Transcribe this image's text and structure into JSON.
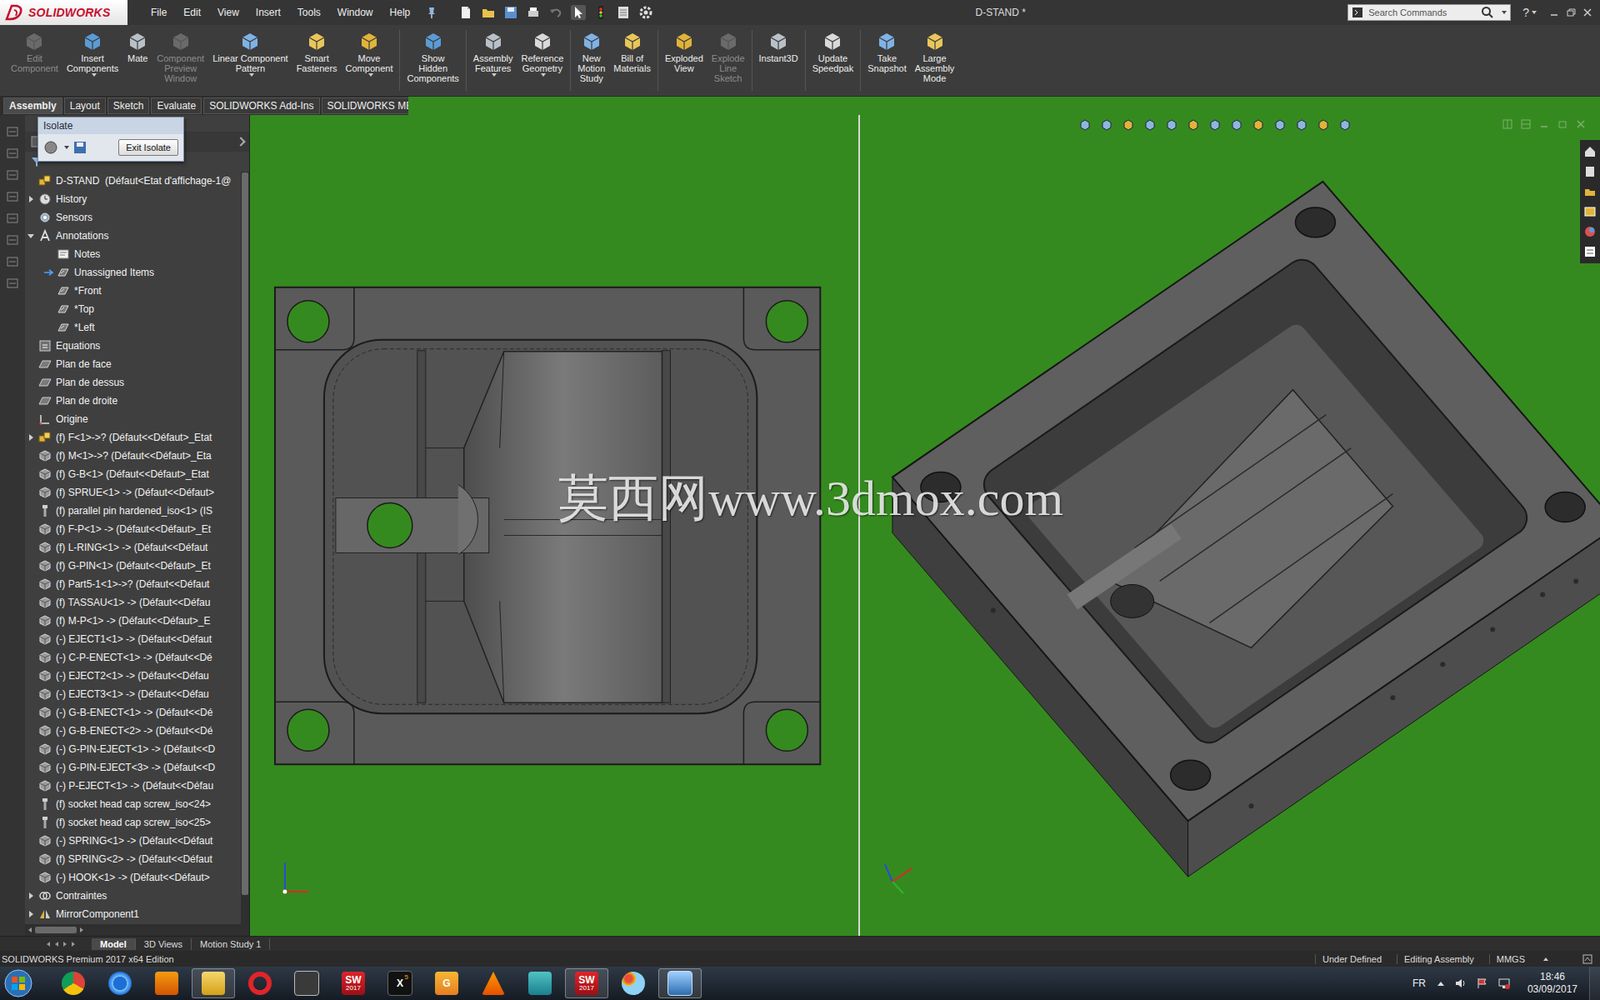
{
  "window": {
    "title": "D-STAND *"
  },
  "logo": {
    "text": "SOLIDWORKS"
  },
  "menu": [
    "File",
    "Edit",
    "View",
    "Insert",
    "Tools",
    "Window",
    "Help"
  ],
  "search": {
    "placeholder": "Search Commands"
  },
  "help": "?",
  "toolbar": [
    {
      "lines": [
        "Edit",
        "Component"
      ],
      "disabled": true,
      "dropdown": false,
      "sep_after": false
    },
    {
      "lines": [
        "Insert",
        "Components"
      ],
      "disabled": false,
      "dropdown": true,
      "sep_after": false
    },
    {
      "lines": [
        "Mate"
      ],
      "disabled": false,
      "dropdown": false,
      "sep_after": false
    },
    {
      "lines": [
        "Component",
        "Preview",
        "Window"
      ],
      "disabled": true,
      "dropdown": false,
      "sep_after": false
    },
    {
      "lines": [
        "Linear Component",
        "Pattern"
      ],
      "disabled": false,
      "dropdown": true,
      "sep_after": false
    },
    {
      "lines": [
        "Smart",
        "Fasteners"
      ],
      "disabled": false,
      "dropdown": false,
      "sep_after": false
    },
    {
      "lines": [
        "Move",
        "Component"
      ],
      "disabled": false,
      "dropdown": true,
      "sep_after": true
    },
    {
      "lines": [
        "Show",
        "Hidden",
        "Components"
      ],
      "disabled": false,
      "dropdown": false,
      "sep_after": true
    },
    {
      "lines": [
        "Assembly",
        "Features"
      ],
      "disabled": false,
      "dropdown": true,
      "sep_after": false
    },
    {
      "lines": [
        "Reference",
        "Geometry"
      ],
      "disabled": false,
      "dropdown": true,
      "sep_after": true
    },
    {
      "lines": [
        "New",
        "Motion",
        "Study"
      ],
      "disabled": false,
      "dropdown": false,
      "sep_after": false
    },
    {
      "lines": [
        "Bill of",
        "Materials"
      ],
      "disabled": false,
      "dropdown": false,
      "sep_after": true
    },
    {
      "lines": [
        "Exploded",
        "View"
      ],
      "disabled": false,
      "dropdown": false,
      "sep_after": false
    },
    {
      "lines": [
        "Explode",
        "Line",
        "Sketch"
      ],
      "disabled": true,
      "dropdown": false,
      "sep_after": true
    },
    {
      "lines": [
        "Instant3D"
      ],
      "disabled": false,
      "dropdown": false,
      "sep_after": true
    },
    {
      "lines": [
        "Update",
        "Speedpak"
      ],
      "disabled": false,
      "dropdown": false,
      "sep_after": true
    },
    {
      "lines": [
        "Take",
        "Snapshot"
      ],
      "disabled": false,
      "dropdown": false,
      "sep_after": false
    },
    {
      "lines": [
        "Large",
        "Assembly",
        "Mode"
      ],
      "disabled": false,
      "dropdown": false,
      "sep_after": false
    }
  ],
  "tabs": [
    {
      "label": "Assembly",
      "selected": true
    },
    {
      "label": "Layout",
      "selected": false
    },
    {
      "label": "Sketch",
      "selected": false
    },
    {
      "label": "Evaluate",
      "selected": false
    },
    {
      "label": "SOLIDWORKS Add-Ins",
      "selected": false
    },
    {
      "label": "SOLIDWORKS MBD",
      "selected": false
    }
  ],
  "isolate": {
    "title": "Isolate",
    "button": "Exit Isolate"
  },
  "tree": {
    "scroll": {
      "level": 0.96
    },
    "rows": [
      {
        "text": "D-STAND  (Défaut<Etat d'affichage-1@",
        "level": 0,
        "kind": "assembly",
        "arrow": "none",
        "marker": false
      },
      {
        "text": "History",
        "level": 1,
        "kind": "history",
        "arrow": "collapsed",
        "marker": false
      },
      {
        "text": "Sensors",
        "level": 1,
        "kind": "sensors",
        "arrow": "none",
        "marker": false
      },
      {
        "text": "Annotations",
        "level": 1,
        "kind": "annotations",
        "arrow": "expanded",
        "marker": false
      },
      {
        "text": "Notes",
        "level": 2,
        "kind": "notes",
        "arrow": "none",
        "marker": false
      },
      {
        "text": "Unassigned Items",
        "level": 2,
        "kind": "view",
        "arrow": "none",
        "marker": true
      },
      {
        "text": "*Front",
        "level": 2,
        "kind": "view",
        "arrow": "none",
        "marker": false
      },
      {
        "text": "*Top",
        "level": 2,
        "kind": "view",
        "arrow": "none",
        "marker": false
      },
      {
        "text": "*Left",
        "level": 2,
        "kind": "view",
        "arrow": "none",
        "marker": false
      },
      {
        "text": "Equations",
        "level": 1,
        "kind": "equations",
        "arrow": "none",
        "marker": false
      },
      {
        "text": "Plan de face",
        "level": 1,
        "kind": "plane",
        "arrow": "none",
        "marker": false
      },
      {
        "text": "Plan de dessus",
        "level": 1,
        "kind": "plane",
        "arrow": "none",
        "marker": false
      },
      {
        "text": "Plan de droite",
        "level": 1,
        "kind": "plane",
        "arrow": "none",
        "marker": false
      },
      {
        "text": "Origine",
        "level": 1,
        "kind": "origin",
        "arrow": "none",
        "marker": false
      },
      {
        "text": "(f) F<1>->? (Défaut<<Défaut>_Etat",
        "level": 1,
        "kind": "assembly",
        "arrow": "collapsed",
        "marker": false
      },
      {
        "text": "(f) M<1>->? (Défaut<<Défaut>_Eta",
        "level": 1,
        "kind": "part",
        "arrow": "none",
        "marker": false
      },
      {
        "text": "(f) G-B<1> (Défaut<<Défaut>_Etat",
        "level": 1,
        "kind": "part",
        "arrow": "none",
        "marker": false
      },
      {
        "text": "(f) SPRUE<1> -> (Défaut<<Défaut>",
        "level": 1,
        "kind": "part",
        "arrow": "none",
        "marker": false
      },
      {
        "text": "(f) parallel pin hardened_iso<1> (IS",
        "level": 1,
        "kind": "fastener",
        "arrow": "none",
        "marker": false
      },
      {
        "text": "(f) F-P<1> -> (Défaut<<Défaut>_Et",
        "level": 1,
        "kind": "part",
        "arrow": "none",
        "marker": false
      },
      {
        "text": "(f) L-RING<1> -> (Défaut<<Défaut",
        "level": 1,
        "kind": "part",
        "arrow": "none",
        "marker": false
      },
      {
        "text": "(f) G-PIN<1> (Défaut<<Défaut>_Et",
        "level": 1,
        "kind": "part",
        "arrow": "none",
        "marker": false
      },
      {
        "text": "(f) Part5-1<1>->? (Défaut<<Défaut",
        "level": 1,
        "kind": "part",
        "arrow": "none",
        "marker": false
      },
      {
        "text": "(f) TASSAU<1> -> (Défaut<<Défau",
        "level": 1,
        "kind": "part",
        "arrow": "none",
        "marker": false
      },
      {
        "text": "(f) M-P<1> -> (Défaut<<Défaut>_E",
        "level": 1,
        "kind": "part",
        "arrow": "none",
        "marker": false
      },
      {
        "text": "(-) EJECT1<1> -> (Défaut<<Défaut",
        "level": 1,
        "kind": "part",
        "arrow": "none",
        "marker": false
      },
      {
        "text": "(-) C-P-ENECT<1> -> (Défaut<<Dé",
        "level": 1,
        "kind": "part",
        "arrow": "none",
        "marker": false
      },
      {
        "text": "(-) EJECT2<1> -> (Défaut<<Défau",
        "level": 1,
        "kind": "part",
        "arrow": "none",
        "marker": false
      },
      {
        "text": "(-) EJECT3<1> -> (Défaut<<Défau",
        "level": 1,
        "kind": "part",
        "arrow": "none",
        "marker": false
      },
      {
        "text": "(-) G-B-ENECT<1> -> (Défaut<<Dé",
        "level": 1,
        "kind": "part",
        "arrow": "none",
        "marker": false
      },
      {
        "text": "(-) G-B-ENECT<2> -> (Défaut<<Dé",
        "level": 1,
        "kind": "part",
        "arrow": "none",
        "marker": false
      },
      {
        "text": "(-) G-PIN-EJECT<1> -> (Défaut<<D",
        "level": 1,
        "kind": "part",
        "arrow": "none",
        "marker": false
      },
      {
        "text": "(-) G-PIN-EJECT<3> -> (Défaut<<D",
        "level": 1,
        "kind": "part",
        "arrow": "none",
        "marker": false
      },
      {
        "text": "(-) P-EJECT<1> -> (Défaut<<Défau",
        "level": 1,
        "kind": "part",
        "arrow": "none",
        "marker": false
      },
      {
        "text": "(f) socket head cap screw_iso<24>",
        "level": 1,
        "kind": "fastener",
        "arrow": "none",
        "marker": false
      },
      {
        "text": "(f) socket head cap screw_iso<25>",
        "level": 1,
        "kind": "fastener",
        "arrow": "none",
        "marker": false
      },
      {
        "text": "(-) SPRING<1> -> (Défaut<<Défaut",
        "level": 1,
        "kind": "part",
        "arrow": "none",
        "marker": false
      },
      {
        "text": "(f) SPRING<2> -> (Défaut<<Défaut",
        "level": 1,
        "kind": "part",
        "arrow": "none",
        "marker": false
      },
      {
        "text": "(-) HOOK<1> -> (Défaut<<Défaut>",
        "level": 1,
        "kind": "part",
        "arrow": "none",
        "marker": false
      },
      {
        "text": "Contraintes",
        "level": 1,
        "kind": "mates",
        "arrow": "collapsed",
        "marker": false
      },
      {
        "text": "MirrorComponent1",
        "level": 1,
        "kind": "mirror",
        "arrow": "collapsed",
        "marker": false
      }
    ]
  },
  "viewport_tabs": [
    {
      "label": "Model",
      "selected": true
    },
    {
      "label": "3D Views",
      "selected": false
    },
    {
      "label": "Motion Study 1",
      "selected": false
    }
  ],
  "watermark": "莫西网www.3dmox.com",
  "status": {
    "product": "SOLIDWORKS Premium 2017 x64 Edition",
    "items": [
      "Under Defined",
      "Editing Assembly",
      "MMGS"
    ]
  },
  "taskbar": {
    "apps": [
      {
        "kind": "chrome",
        "text": "",
        "sub": "",
        "selected": false
      },
      {
        "kind": "ie",
        "text": "",
        "sub": "",
        "selected": false
      },
      {
        "kind": "media",
        "text": "",
        "sub": "",
        "selected": false
      },
      {
        "kind": "explorer",
        "text": "",
        "sub": "",
        "selected": true
      },
      {
        "kind": "opera",
        "text": "",
        "sub": "",
        "selected": false
      },
      {
        "kind": "ds",
        "text": "",
        "sub": "",
        "selected": false
      },
      {
        "kind": "sw",
        "text": "SW",
        "sub": "2017",
        "selected": false
      },
      {
        "kind": "x5",
        "text": "X",
        "sub": "5",
        "selected": false
      },
      {
        "kind": "gpdf",
        "text": "G",
        "sub": "",
        "selected": false
      },
      {
        "kind": "vlc",
        "text": "",
        "sub": "",
        "selected": false
      },
      {
        "kind": "m",
        "text": "",
        "sub": "",
        "selected": false
      },
      {
        "kind": "sw",
        "text": "SW",
        "sub": "2017",
        "selected": true
      },
      {
        "kind": "paint",
        "text": "",
        "sub": "",
        "selected": false
      },
      {
        "kind": "window",
        "text": "",
        "sub": "",
        "selected": true
      }
    ],
    "lang": "FR",
    "time": "18:46",
    "date": "03/09/2017"
  }
}
